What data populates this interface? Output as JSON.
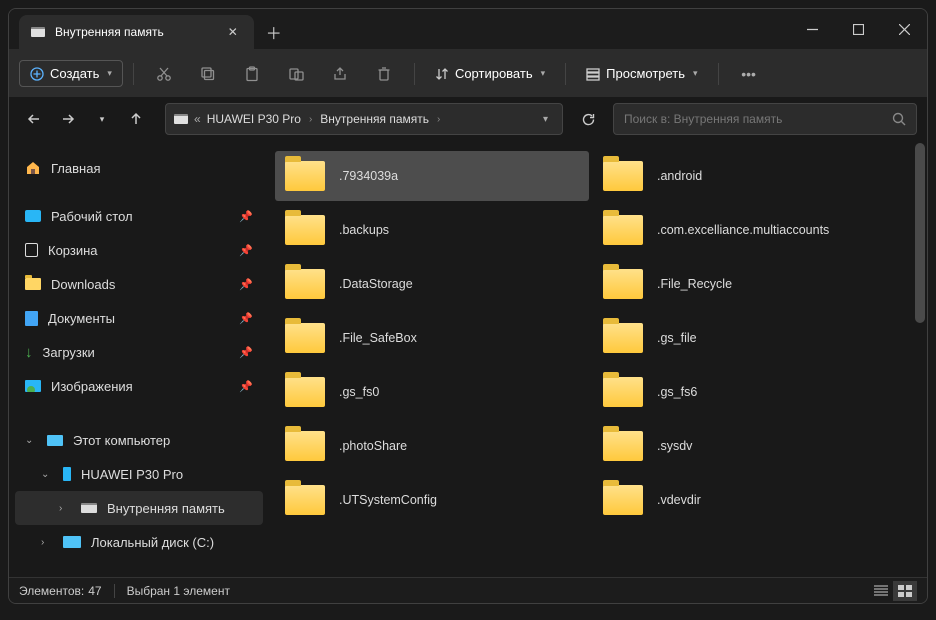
{
  "tab": {
    "title": "Внутренняя память"
  },
  "toolbar": {
    "create": "Создать",
    "sort": "Сортировать",
    "view": "Просмотреть"
  },
  "breadcrumb": {
    "parts": [
      "HUAWEI P30 Pro",
      "Внутренняя память"
    ]
  },
  "search": {
    "placeholder": "Поиск в: Внутренняя память"
  },
  "sidebar": {
    "home": "Главная",
    "desktop": "Рабочий стол",
    "trash": "Корзина",
    "downloads": "Downloads",
    "documents": "Документы",
    "zagruzki": "Загрузки",
    "images": "Изображения",
    "thispc": "Этот компьютер",
    "phone": "HUAWEI P30 Pro",
    "internal": "Внутренняя память",
    "localdisk": "Локальный диск (C:)"
  },
  "files": [
    ".7934039a",
    ".android",
    ".backups",
    ".com.excelliance.multiaccounts",
    ".DataStorage",
    ".File_Recycle",
    ".File_SafeBox",
    ".gs_file",
    ".gs_fs0",
    ".gs_fs6",
    ".photoShare",
    ".sysdv",
    ".UTSystemConfig",
    ".vdevdir"
  ],
  "selected_index": 0,
  "status": {
    "elements_label": "Элементов:",
    "elements_count": "47",
    "selected": "Выбран 1 элемент"
  }
}
